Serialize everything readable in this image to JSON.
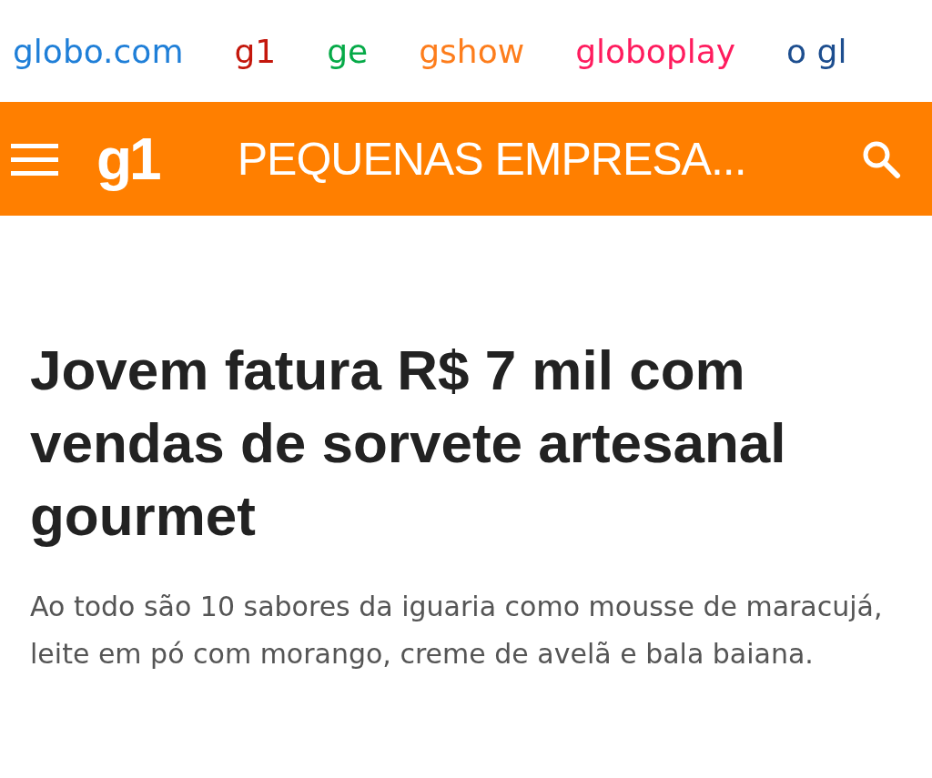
{
  "top_links": [
    {
      "label": "globo.com",
      "color": "#1f7fd8"
    },
    {
      "label": "g1",
      "color": "#c4170c"
    },
    {
      "label": "ge",
      "color": "#06aa48"
    },
    {
      "label": "gshow",
      "color": "#fd7d1c"
    },
    {
      "label": "globoplay",
      "color": "#ff1c5e"
    },
    {
      "label": "o gl",
      "color": "#1d4e8f"
    }
  ],
  "header": {
    "logo": "g1",
    "section": "PEQUENAS EMPRESA..."
  },
  "article": {
    "headline": "Jovem fatura R$ 7 mil com vendas de sorvete artesanal gourmet",
    "summary": "Ao todo são 10 sabores da iguaria como mousse de maracujá, leite em pó com morango, creme de avelã e bala baiana."
  }
}
